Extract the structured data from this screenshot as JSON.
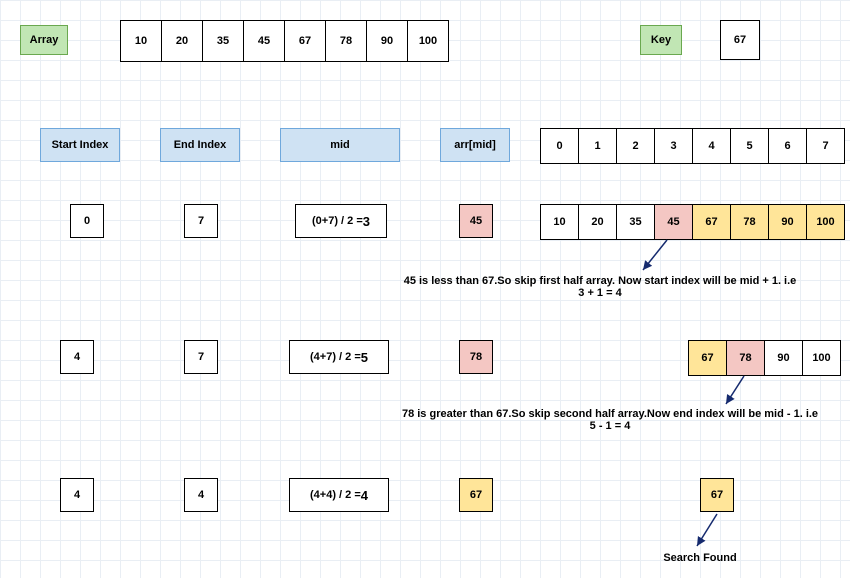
{
  "header": {
    "array_label": "Array",
    "array_values": [
      "10",
      "20",
      "35",
      "45",
      "67",
      "78",
      "90",
      "100"
    ],
    "key_label": "Key",
    "key_value": "67"
  },
  "columns": {
    "start_index": "Start Index",
    "end_index": "End Index",
    "mid": "mid",
    "arr_mid": "arr[mid]",
    "index_header": [
      "0",
      "1",
      "2",
      "3",
      "4",
      "5",
      "6",
      "7"
    ]
  },
  "step1": {
    "start": "0",
    "end": "7",
    "mid_expr_prefix": "(0+7) / 2 = ",
    "mid_expr_bold": "3",
    "arr_mid": "45",
    "array": [
      "10",
      "20",
      "35",
      "45",
      "67",
      "78",
      "90",
      "100"
    ],
    "note_l1": "45 is less than 67.So skip first half array. Now start index will be mid + 1.  i.e",
    "note_l2": "3 + 1 = 4"
  },
  "step2": {
    "start": "4",
    "end": "7",
    "mid_expr_prefix": "(4+7) / 2 = ",
    "mid_expr_bold": "5",
    "arr_mid": "78",
    "array": [
      "67",
      "78",
      "90",
      "100"
    ],
    "note_l1": "78 is greater than 67.So skip second half array.Now end index will be mid - 1. i.e",
    "note_l2": "5 - 1 = 4"
  },
  "step3": {
    "start": "4",
    "end": "4",
    "mid_expr_prefix": "(4+4) / 2 = ",
    "mid_expr_bold": "4",
    "arr_mid": "67",
    "array_single": "67",
    "result": "Search Found"
  }
}
